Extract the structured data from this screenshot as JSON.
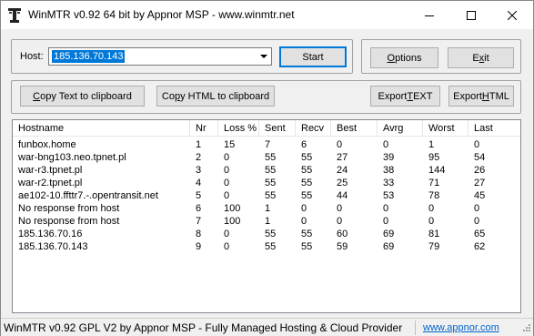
{
  "window": {
    "title": "WinMTR v0.92 64 bit by Appnor MSP - www.winmtr.net",
    "min_label": "",
    "max_label": "",
    "close_label": ""
  },
  "host": {
    "label": "Host:",
    "value": "185.136.70.143"
  },
  "buttons": {
    "start": "Start",
    "options_pre": "",
    "options_u": "O",
    "options_post": "ptions",
    "exit_pre": "E",
    "exit_u": "x",
    "exit_post": "it",
    "copy_text_pre": "",
    "copy_text_u": "C",
    "copy_text_post": "opy Text to clipboard",
    "copy_html_pre": "Co",
    "copy_html_u": "p",
    "copy_html_post": "y HTML to clipboard",
    "export_text_pre": "Export ",
    "export_text_u": "T",
    "export_text_post": "EXT",
    "export_html_pre": "Export ",
    "export_html_u": "H",
    "export_html_post": "TML"
  },
  "table": {
    "columns": [
      "Hostname",
      "Nr",
      "Loss %",
      "Sent",
      "Recv",
      "Best",
      "Avrg",
      "Worst",
      "Last"
    ],
    "rows": [
      [
        "funbox.home",
        "1",
        "15",
        "7",
        "6",
        "0",
        "0",
        "1",
        "0"
      ],
      [
        "war-bng103.neo.tpnet.pl",
        "2",
        "0",
        "55",
        "55",
        "27",
        "39",
        "95",
        "54"
      ],
      [
        "war-r3.tpnet.pl",
        "3",
        "0",
        "55",
        "55",
        "24",
        "38",
        "144",
        "26"
      ],
      [
        "war-r2.tpnet.pl",
        "4",
        "0",
        "55",
        "55",
        "25",
        "33",
        "71",
        "27"
      ],
      [
        "ae102-10.ffttr7.-.opentransit.net",
        "5",
        "0",
        "55",
        "55",
        "44",
        "53",
        "78",
        "45"
      ],
      [
        "No response from host",
        "6",
        "100",
        "1",
        "0",
        "0",
        "0",
        "0",
        "0"
      ],
      [
        "No response from host",
        "7",
        "100",
        "1",
        "0",
        "0",
        "0",
        "0",
        "0"
      ],
      [
        "185.136.70.16",
        "8",
        "0",
        "55",
        "55",
        "60",
        "69",
        "81",
        "65"
      ],
      [
        "185.136.70.143",
        "9",
        "0",
        "55",
        "55",
        "59",
        "69",
        "79",
        "62"
      ]
    ]
  },
  "status": {
    "text": "WinMTR v0.92 GPL V2 by Appnor MSP - Fully Managed Hosting & Cloud Provider",
    "link": "www.appnor.com"
  },
  "colors": {
    "selection": "#0078d7",
    "link": "#0066cc",
    "background": "#f0f0f0"
  }
}
